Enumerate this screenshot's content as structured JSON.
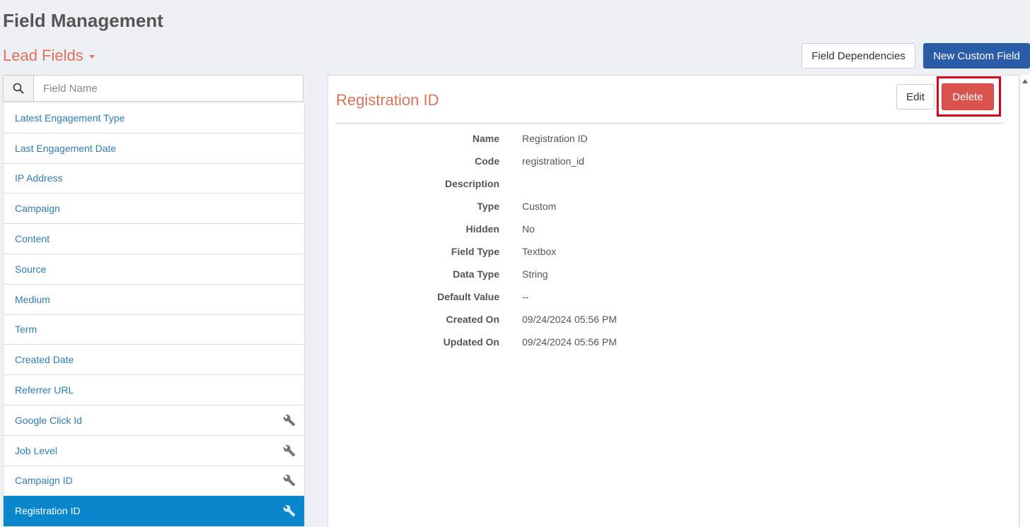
{
  "page": {
    "title": "Field Management"
  },
  "section": {
    "title": "Lead Fields"
  },
  "toolbar": {
    "dependencies_label": "Field Dependencies",
    "new_custom_label": "New Custom Field"
  },
  "search": {
    "placeholder": "Field Name",
    "value": ""
  },
  "fields": [
    {
      "label": "Latest Engagement Type",
      "custom": false
    },
    {
      "label": "Last Engagement Date",
      "custom": false
    },
    {
      "label": "IP Address",
      "custom": false
    },
    {
      "label": "Campaign",
      "custom": false
    },
    {
      "label": "Content",
      "custom": false
    },
    {
      "label": "Source",
      "custom": false
    },
    {
      "label": "Medium",
      "custom": false
    },
    {
      "label": "Term",
      "custom": false
    },
    {
      "label": "Created Date",
      "custom": false
    },
    {
      "label": "Referrer URL",
      "custom": false
    },
    {
      "label": "Google Click Id",
      "custom": true
    },
    {
      "label": "Job Level",
      "custom": true
    },
    {
      "label": "Campaign ID",
      "custom": true
    },
    {
      "label": "Registration ID",
      "custom": true,
      "active": true
    }
  ],
  "detail": {
    "title": "Registration ID",
    "edit_label": "Edit",
    "delete_label": "Delete",
    "properties": [
      {
        "label": "Name",
        "value": "Registration ID"
      },
      {
        "label": "Code",
        "value": "registration_id"
      },
      {
        "label": "Description",
        "value": ""
      },
      {
        "label": "Type",
        "value": "Custom"
      },
      {
        "label": "Hidden",
        "value": "No"
      },
      {
        "label": "Field Type",
        "value": "Textbox"
      },
      {
        "label": "Data Type",
        "value": "String"
      },
      {
        "label": "Default Value",
        "value": "--"
      },
      {
        "label": "Created On",
        "value": "09/24/2024 05:56 PM"
      },
      {
        "label": "Updated On",
        "value": "09/24/2024 05:56 PM"
      }
    ]
  },
  "colors": {
    "accent": "#e0725a",
    "primary": "#2a5ca8",
    "active_row": "#0a87cc",
    "danger": "#d9534f",
    "highlight": "#d8001a",
    "link": "#2f7db3"
  },
  "icons": {
    "search": "search-icon",
    "custom_field": "wrench-icon",
    "dropdown": "caret-down-icon",
    "scroll_up": "scroll-up-arrow-icon"
  }
}
